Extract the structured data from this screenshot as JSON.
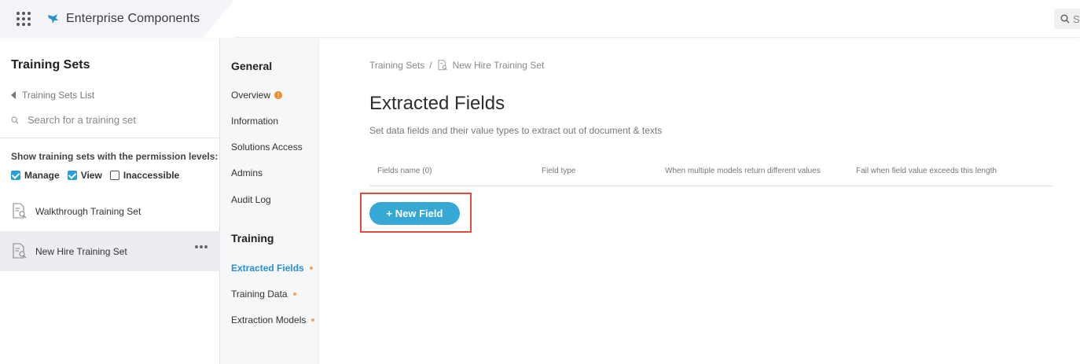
{
  "topbar": {
    "app_title": "Enterprise Components",
    "search_partial": "S",
    "logo_color": "#2a8fd0"
  },
  "sidebar": {
    "title": "Training Sets",
    "back_label": "Training Sets List",
    "search_placeholder": "Search for a training set",
    "permission_label": "Show training sets with the permission levels:",
    "filters": [
      {
        "label": "Manage",
        "checked": true
      },
      {
        "label": "View",
        "checked": true
      },
      {
        "label": "Inaccessible",
        "checked": false
      }
    ],
    "training_sets": [
      {
        "label": "Walkthrough Training Set",
        "active": false
      },
      {
        "label": "New Hire Training Set",
        "active": true
      }
    ]
  },
  "nav": {
    "general_heading": "General",
    "general_items": [
      "Overview",
      "Information",
      "Solutions Access",
      "Admins",
      "Audit Log"
    ],
    "training_heading": "Training",
    "training_items": [
      "Extracted Fields",
      "Training Data",
      "Extraction Models"
    ],
    "active_item": "Extracted Fields",
    "accent_color": "#2a8fd0",
    "warn_color": "#f08a24"
  },
  "main": {
    "breadcrumb_root": "Training Sets",
    "breadcrumb_current": "New Hire Training Set",
    "title": "Extracted Fields",
    "subtitle": "Set data fields and their value types to extract out of document & texts",
    "columns": [
      "Fields name (0)",
      "Field type",
      "When multiple models return different values",
      "Fail when field value exceeds this length"
    ],
    "new_field_label": "+ New Field",
    "button_color": "#35a9d4",
    "highlight_color": "#e04b3c"
  }
}
